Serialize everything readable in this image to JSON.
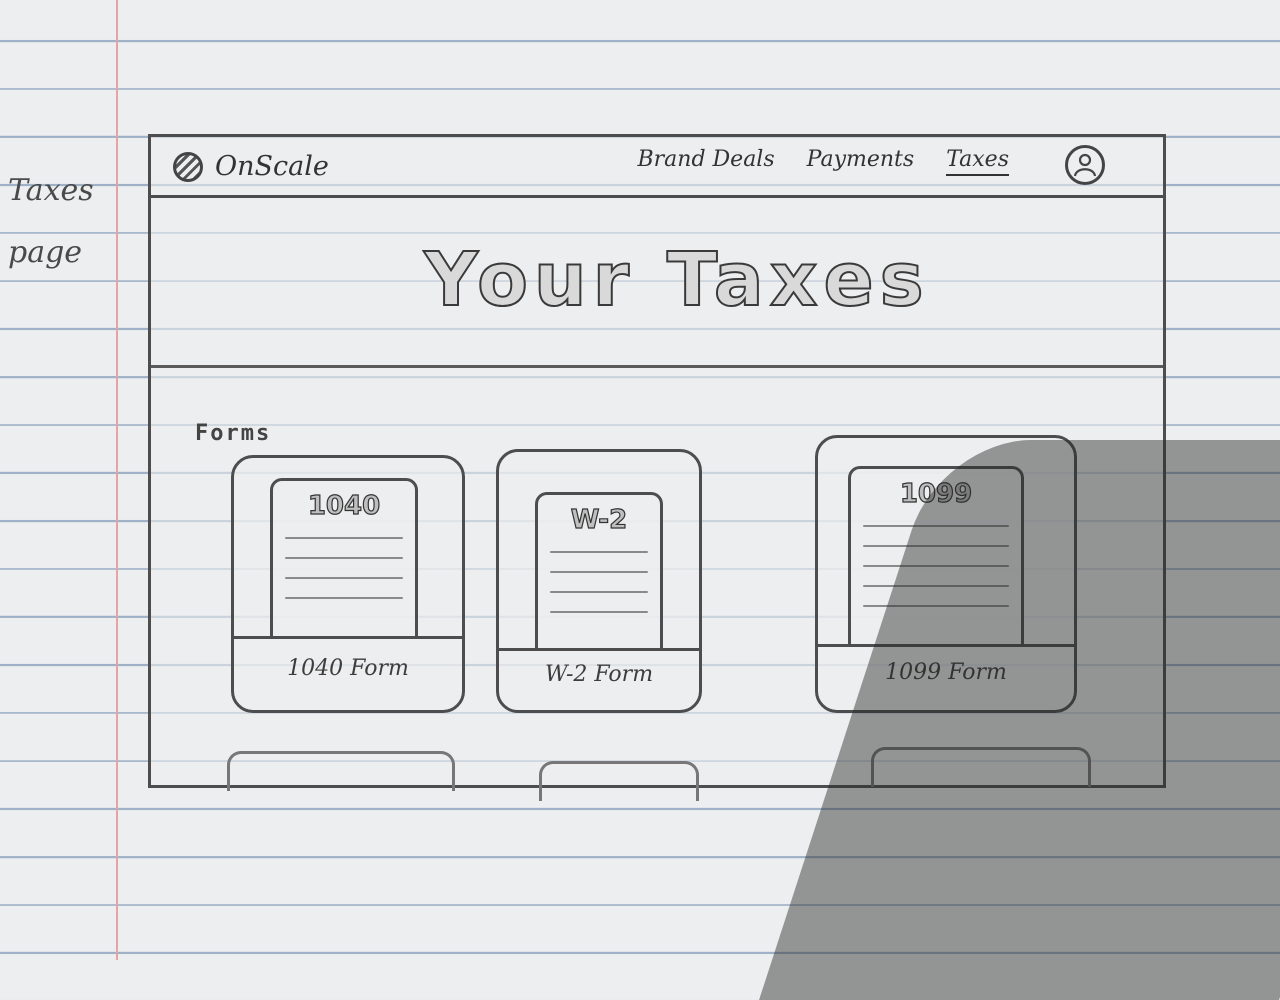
{
  "note": {
    "line1": "Taxes",
    "line2": "page"
  },
  "app": {
    "name": "OnScale",
    "logo_icon": "onscale-logo-icon"
  },
  "nav": {
    "links": [
      {
        "label": "Brand Deals",
        "active": false
      },
      {
        "label": "Payments",
        "active": false
      },
      {
        "label": "Taxes",
        "active": true
      }
    ],
    "profile_icon": "user-icon"
  },
  "hero": {
    "title": "Your Taxes"
  },
  "forms": {
    "label": "Forms",
    "cards": [
      {
        "doc_title": "1040",
        "label": "1040 Form"
      },
      {
        "doc_title": "W-2",
        "label": "W-2 Form"
      },
      {
        "doc_title": "1099",
        "label": "1099 Form"
      }
    ]
  }
}
